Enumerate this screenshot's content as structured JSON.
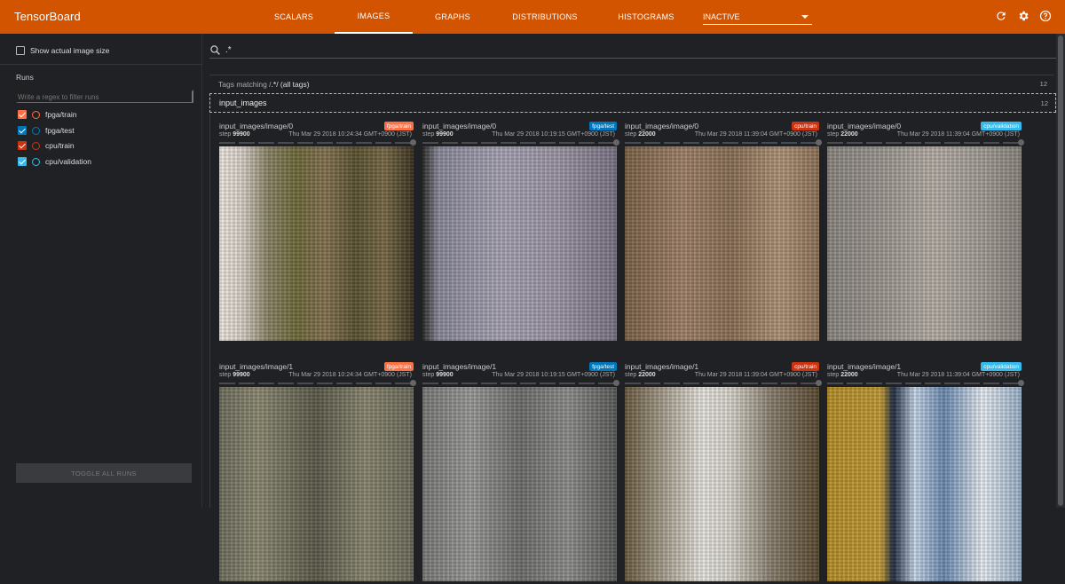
{
  "app": {
    "title": "TensorBoard"
  },
  "nav": {
    "tabs": [
      {
        "label": "SCALARS"
      },
      {
        "label": "IMAGES"
      },
      {
        "label": "GRAPHS"
      },
      {
        "label": "DISTRIBUTIONS"
      },
      {
        "label": "HISTOGRAMS"
      }
    ],
    "active_tab": "IMAGES",
    "inactive_dropdown": "INACTIVE",
    "icons": [
      "refresh-icon",
      "gear-icon",
      "help-icon"
    ]
  },
  "sidebar": {
    "show_actual_size_label": "Show actual image size",
    "runs_title": "Runs",
    "regex_placeholder": "Write a regex to filter runs",
    "runs": [
      {
        "label": "fpga/train",
        "color": "#ff7043"
      },
      {
        "label": "fpga/test",
        "color": "#0077bb"
      },
      {
        "label": "cpu/train",
        "color": "#cc3311"
      },
      {
        "label": "cpu/validation",
        "color": "#33bbee"
      }
    ],
    "toggle_all_label": "TOGGLE ALL RUNS"
  },
  "main": {
    "search_value": ".*",
    "tags_matching_prefix": "Tags matching /",
    "tags_matching_regex": ".*",
    "tags_matching_suffix": "/ (all tags)",
    "tags_count": "12",
    "group_name": "input_images",
    "group_count": "12",
    "cards": [
      {
        "title": "input_images/image/0",
        "run": "fpga/train",
        "step_label": "step",
        "step": "99900",
        "time": "Thu Mar 29 2018 10:24:34 GMT+0900 (JST)"
      },
      {
        "title": "input_images/image/0",
        "run": "fpga/test",
        "step_label": "step",
        "step": "99900",
        "time": "Thu Mar 29 2018 10:19:15 GMT+0900 (JST)"
      },
      {
        "title": "input_images/image/0",
        "run": "cpu/train",
        "step_label": "step",
        "step": "22000",
        "time": "Thu Mar 29 2018 11:39:04 GMT+0900 (JST)"
      },
      {
        "title": "input_images/image/0",
        "run": "cpu/validation",
        "step_label": "step",
        "step": "22000",
        "time": "Thu Mar 29 2018 11:39:04 GMT+0900 (JST)"
      },
      {
        "title": "input_images/image/1",
        "run": "fpga/train",
        "step_label": "step",
        "step": "99900",
        "time": "Thu Mar 29 2018 10:24:34 GMT+0900 (JST)"
      },
      {
        "title": "input_images/image/1",
        "run": "fpga/test",
        "step_label": "step",
        "step": "99900",
        "time": "Thu Mar 29 2018 10:19:15 GMT+0900 (JST)"
      },
      {
        "title": "input_images/image/1",
        "run": "cpu/train",
        "step_label": "step",
        "step": "22000",
        "time": "Thu Mar 29 2018 11:39:04 GMT+0900 (JST)"
      },
      {
        "title": "input_images/image/1",
        "run": "cpu/validation",
        "step_label": "step",
        "step": "22000",
        "time": "Thu Mar 29 2018 11:39:04 GMT+0900 (JST)"
      }
    ]
  },
  "colors": {
    "header": "#d35400",
    "background": "#202124"
  }
}
